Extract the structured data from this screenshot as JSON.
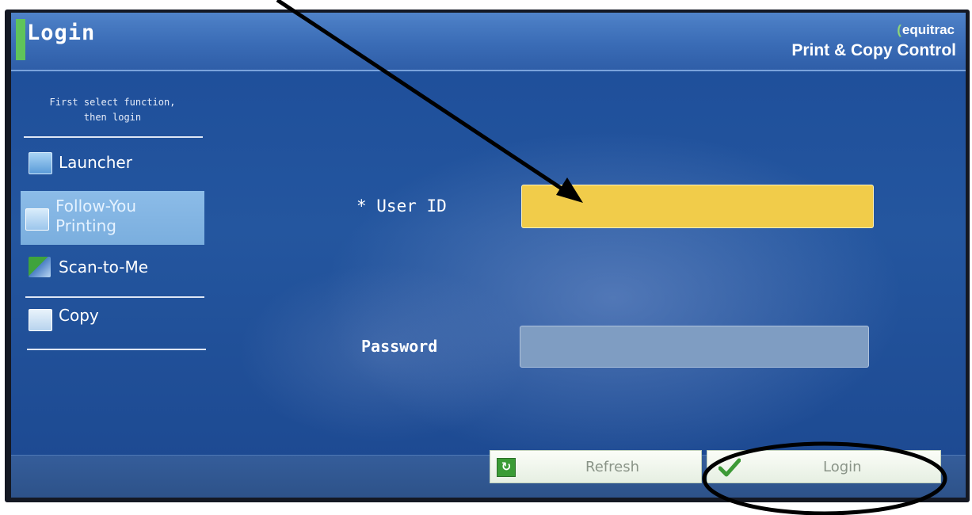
{
  "header": {
    "title": "Login",
    "brand_name": "equitrac",
    "brand_tagline": "Print & Copy Control"
  },
  "sidebar": {
    "hint_line1": "First select function,",
    "hint_line2": "then login",
    "items": [
      {
        "label": "Launcher",
        "icon": "launcher-icon",
        "selected": false
      },
      {
        "label_line1": "Follow-You",
        "label_line2": "Printing",
        "icon": "follow-you-printing-icon",
        "selected": true
      },
      {
        "label": "Scan-to-Me",
        "icon": "scan-to-me-icon",
        "selected": false
      },
      {
        "label": "Copy",
        "icon": "copy-icon",
        "selected": false
      }
    ]
  },
  "form": {
    "user_id_label": "* User ID",
    "user_id_value": "",
    "password_label": "Password",
    "password_value": ""
  },
  "footer": {
    "refresh_label": "Refresh",
    "login_label": "Login"
  },
  "colors": {
    "screen_blue": "#24569f",
    "header_blue": "#3a6cb6",
    "active_field": "#f1cc4a",
    "selected_item": "#7aaede",
    "refresh_green": "#3a9b35",
    "brand_green": "#8ed47a"
  }
}
